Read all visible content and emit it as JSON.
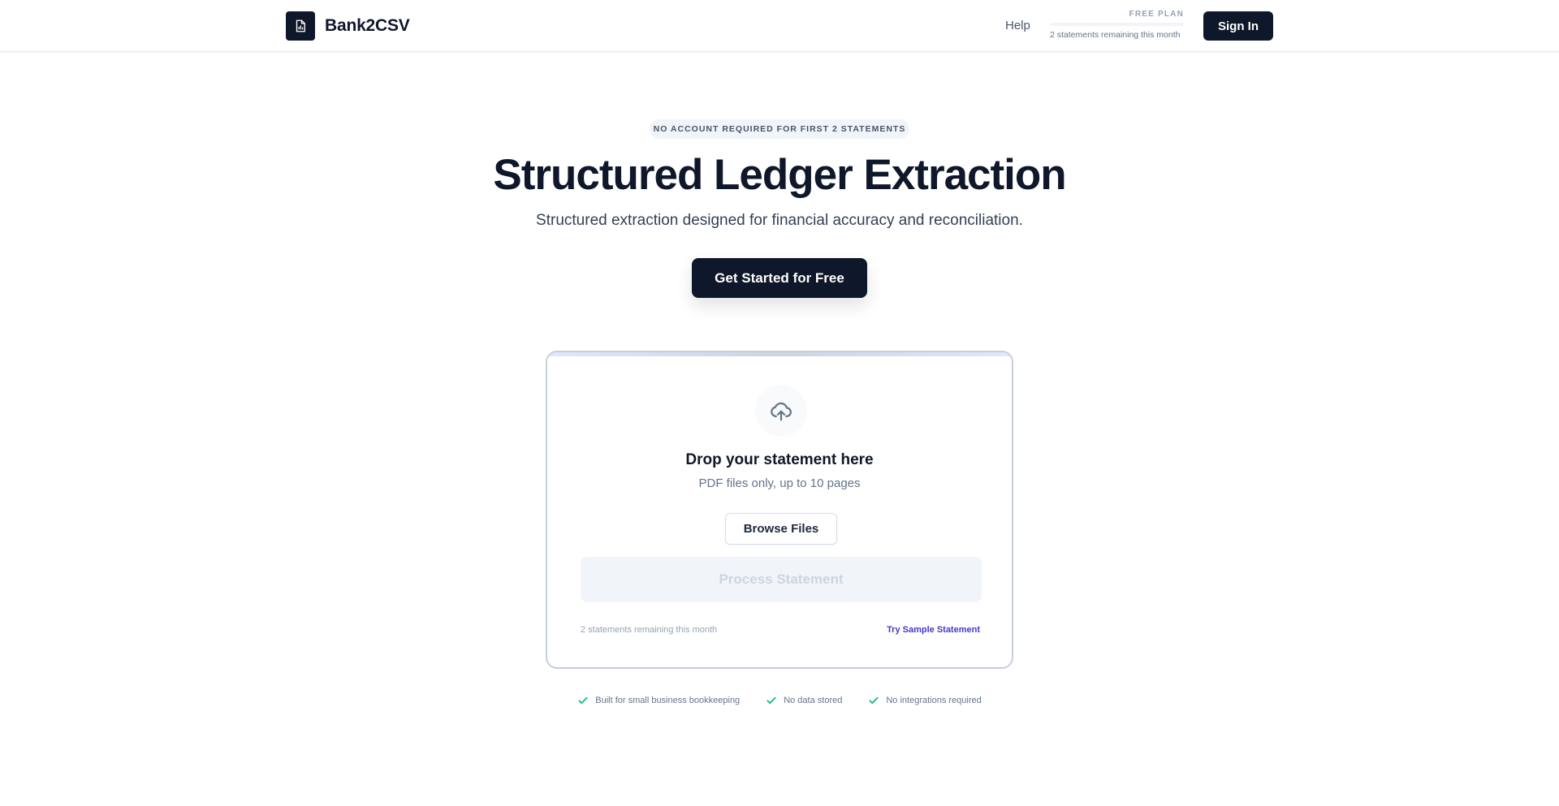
{
  "header": {
    "brand": "Bank2CSV",
    "help": "Help",
    "plan_label": "FREE PLAN",
    "plan_remaining": "2 statements remaining this month",
    "plan_usage_fraction": 0,
    "sign_in": "Sign In"
  },
  "hero": {
    "badge": "NO ACCOUNT REQUIRED FOR FIRST 2 STATEMENTS",
    "title": "Structured Ledger Extraction",
    "subtitle": "Structured extraction designed for financial accuracy and reconciliation.",
    "cta": "Get Started for Free"
  },
  "upload": {
    "icon": "cloud-upload-icon",
    "title": "Drop your statement here",
    "subtitle": "PDF files only, up to 10 pages",
    "browse": "Browse Files",
    "process": "Process Statement",
    "remaining": "2 statements remaining this month",
    "sample": "Try Sample Statement"
  },
  "features": [
    {
      "label": "Built for small business bookkeeping",
      "icon": "check-icon"
    },
    {
      "label": "No data stored",
      "icon": "check-icon"
    },
    {
      "label": "No integrations required",
      "icon": "check-icon"
    }
  ],
  "colors": {
    "primary": "#0f172a",
    "accent_link": "#4338ca",
    "check": "#10b981",
    "muted": "#64748b"
  }
}
